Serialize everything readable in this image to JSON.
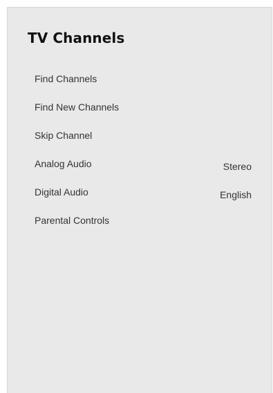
{
  "menu": {
    "title": "TV Channels",
    "items": [
      {
        "label": "Find Channels",
        "value": ""
      },
      {
        "label": "Find New Channels",
        "value": ""
      },
      {
        "label": "Skip Channel",
        "value": ""
      },
      {
        "label": "Analog Audio",
        "value": "Stereo"
      },
      {
        "label": "Digital Audio",
        "value": "English"
      },
      {
        "label": "Parental Controls",
        "value": ""
      }
    ]
  }
}
